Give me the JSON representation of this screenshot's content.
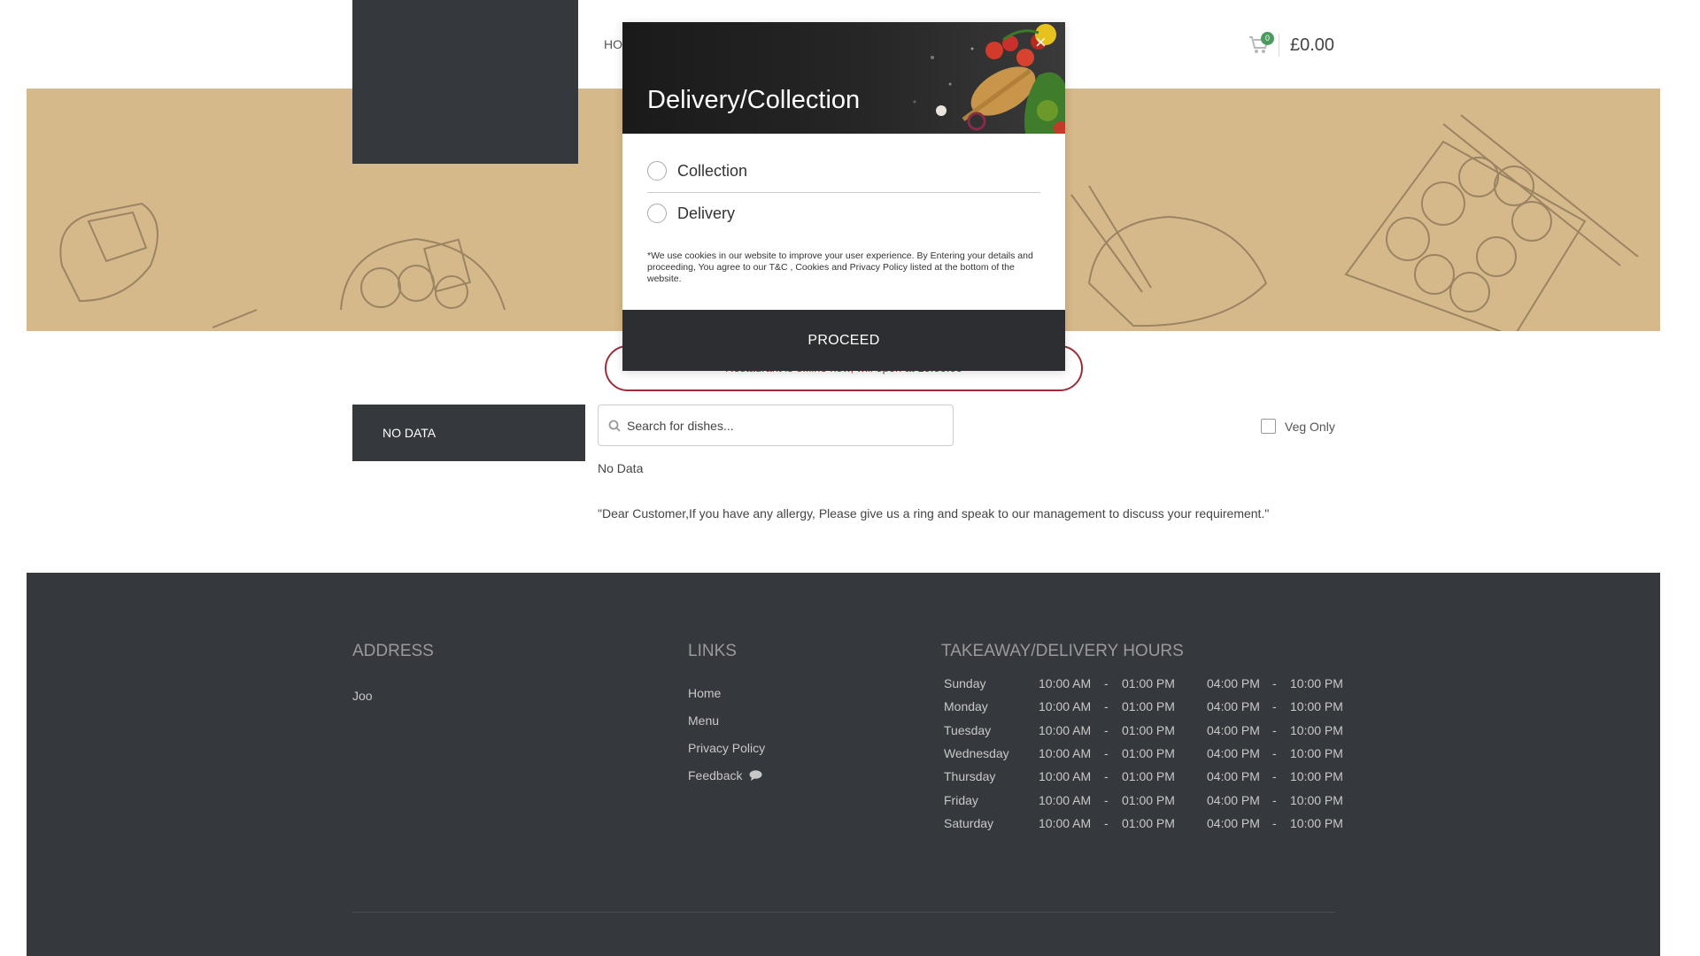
{
  "header": {
    "nav_home": "HO",
    "cart_count": "0",
    "cart_total": "£0.00"
  },
  "notice": {
    "text": "Restaurant is offline now, will open at 10:00:00"
  },
  "menu": {
    "category_box": "NO DATA",
    "search_placeholder": "Search for dishes...",
    "veg_only_label": "Veg Only",
    "no_data": "No Data",
    "allergy_note": "\"Dear Customer,If you have any allergy, Please give us a ring and speak to our management to discuss your requirement.\""
  },
  "footer": {
    "address_heading": "ADDRESS",
    "address_text": "Joo",
    "links_heading": "LINKS",
    "links": [
      "Home",
      "Menu",
      "Privacy Policy",
      "Feedback"
    ],
    "hours_heading": "TAKEAWAY/DELIVERY HOURS",
    "hours": [
      {
        "day": "Sunday",
        "o1": "10:00 AM",
        "c1": "01:00 PM",
        "o2": "04:00 PM",
        "c2": "10:00 PM"
      },
      {
        "day": "Monday",
        "o1": "10:00 AM",
        "c1": "01:00 PM",
        "o2": "04:00 PM",
        "c2": "10:00 PM"
      },
      {
        "day": "Tuesday",
        "o1": "10:00 AM",
        "c1": "01:00 PM",
        "o2": "04:00 PM",
        "c2": "10:00 PM"
      },
      {
        "day": "Wednesday",
        "o1": "10:00 AM",
        "c1": "01:00 PM",
        "o2": "04:00 PM",
        "c2": "10:00 PM"
      },
      {
        "day": "Thursday",
        "o1": "10:00 AM",
        "c1": "01:00 PM",
        "o2": "04:00 PM",
        "c2": "10:00 PM"
      },
      {
        "day": "Friday",
        "o1": "10:00 AM",
        "c1": "01:00 PM",
        "o2": "04:00 PM",
        "c2": "10:00 PM"
      },
      {
        "day": "Saturday",
        "o1": "10:00 AM",
        "c1": "01:00 PM",
        "o2": "04:00 PM",
        "c2": "10:00 PM"
      }
    ],
    "dash": "-"
  },
  "modal": {
    "title": "Delivery/Collection",
    "close_symbol": "×",
    "options": [
      "Collection",
      "Delivery"
    ],
    "cookie_text": "*We use cookies in our website to improve your user experience. By Entering your details and proceeding, You agree to our T&C , Cookies and Privacy Policy listed at the bottom of the website.",
    "proceed_label": "PROCEED"
  },
  "colors": {
    "dark": "#35383c",
    "banner": "#d6b98a",
    "accent_red": "#9a2e3a",
    "badge_green": "#4b9a5e"
  },
  "icons": [
    "cart-icon",
    "search-icon",
    "chat-icon",
    "close-icon"
  ]
}
